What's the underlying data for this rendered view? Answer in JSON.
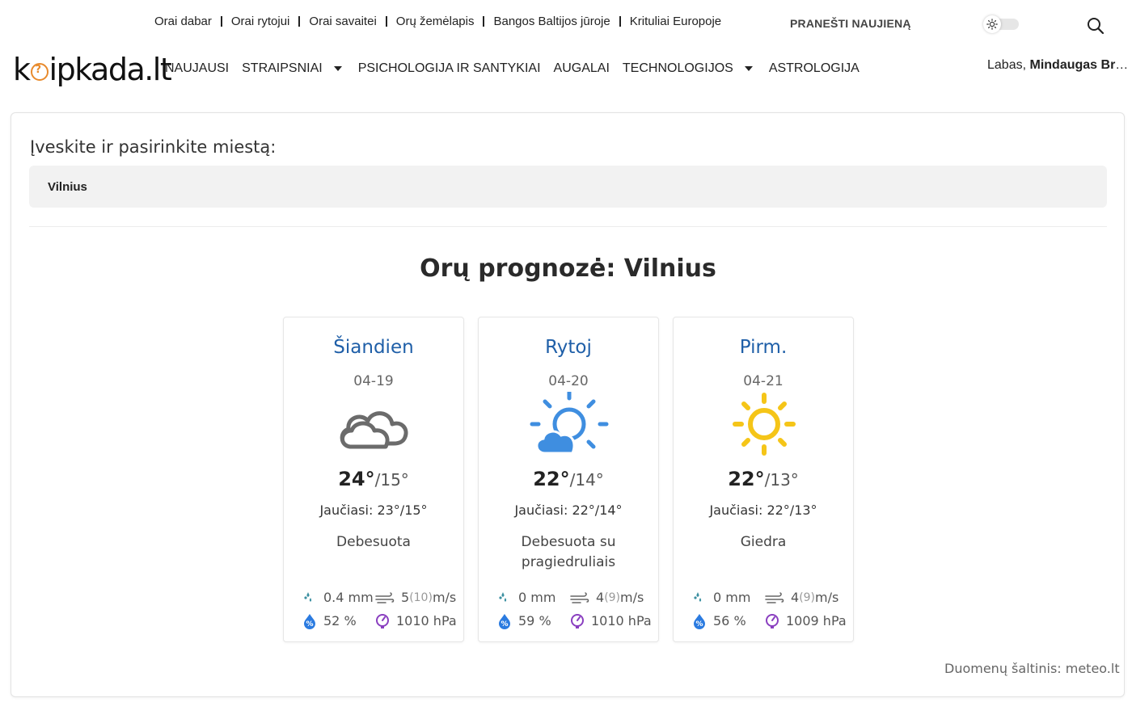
{
  "top_links": [
    "Orai dabar",
    "Orai rytojui",
    "Orai savaitei",
    "Orų žemėlapis",
    "Bangos Baltijos jūroje",
    "Krituliai Europoje"
  ],
  "report_label": "PRANEŠTI NAUJIENĄ",
  "logo": {
    "pre": "k",
    "post": "ipkada.lt"
  },
  "nav": [
    {
      "label": "NAUJAUSI",
      "dropdown": false
    },
    {
      "label": "STRAIPSNIAI",
      "dropdown": true
    },
    {
      "label": "PSICHOLOGIJA IR SANTYKIAI",
      "dropdown": false
    },
    {
      "label": "AUGALAI",
      "dropdown": false
    },
    {
      "label": "TECHNOLOGIJOS",
      "dropdown": true
    },
    {
      "label": "ASTROLOGIJA",
      "dropdown": false
    }
  ],
  "greeting": {
    "prefix": "Labas,",
    "name": "Mindaugas Bru..."
  },
  "city_label": "Įveskite ir pasirinkite miestą:",
  "city_value": "Vilnius",
  "forecast_title": "Orų prognozė: Vilnius",
  "cards": [
    {
      "day": "Šiandien",
      "date": "04-19",
      "icon": "cloud-icon",
      "hi": "24°",
      "lo": "/15°",
      "feels_label": "Jaučiasi:",
      "feels_hi": "23°",
      "feels_lo": "/15°",
      "condition": "Debesuota",
      "precip": "0.4 mm",
      "wind": "5",
      "gust": "(10)",
      "wind_unit": "m/s",
      "humidity": "52 %",
      "pressure": "1010 hPa"
    },
    {
      "day": "Rytoj",
      "date": "04-20",
      "icon": "partly-sunny-icon",
      "hi": "22°",
      "lo": "/14°",
      "feels_label": "Jaučiasi:",
      "feels_hi": "22°",
      "feels_lo": "/14°",
      "condition": "Debesuota su pragiedruliais",
      "precip": "0 mm",
      "wind": "4",
      "gust": "(9)",
      "wind_unit": "m/s",
      "humidity": "59 %",
      "pressure": "1010 hPa"
    },
    {
      "day": "Pirm.",
      "date": "04-21",
      "icon": "sun-icon",
      "hi": "22°",
      "lo": "/13°",
      "feels_label": "Jaučiasi:",
      "feels_hi": "22°",
      "feels_lo": "/13°",
      "condition": "Giedra",
      "precip": "0 mm",
      "wind": "4",
      "gust": "(9)",
      "wind_unit": "m/s",
      "humidity": "56 %",
      "pressure": "1009 hPa"
    }
  ],
  "source": "Duomenų šaltinis: meteo.lt",
  "colors": {
    "day_title": "#1f5fa8",
    "cloud_icon": "#6b6b6b",
    "partly_sunny_icon": "#3f8ee0",
    "sun_icon": "#f5c518",
    "precip_icon": "#3a8fa0",
    "humidity_icon": "#2b7be0",
    "pressure_icon": "#8a3fc0",
    "logo_accent": "#e88a2c"
  }
}
